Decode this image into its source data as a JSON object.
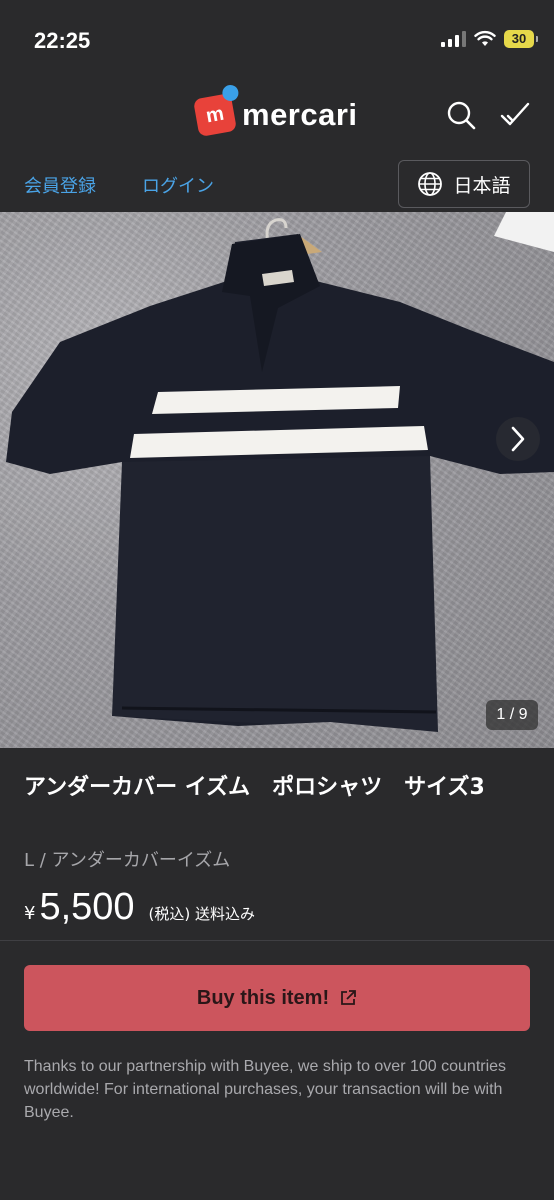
{
  "status_bar": {
    "time": "22:25",
    "battery": "30"
  },
  "header": {
    "logo_text": "mercari",
    "logo_mark": "m",
    "icons": [
      "search-icon",
      "check-icon"
    ]
  },
  "sub_nav": {
    "register": "会員登録",
    "login": "ログイン",
    "language": "日本語"
  },
  "gallery": {
    "counter": "1 / 9"
  },
  "item": {
    "title": "アンダーカバー イズム　ポロシャツ　サイズ3",
    "subtitle": "L / アンダーカバーイズム",
    "currency": "¥",
    "price": "5,500",
    "price_note": "(税込) 送料込み"
  },
  "buy": {
    "label": "Buy this item!"
  },
  "disclaimer": "Thanks to our partnership with Buyee, we ship to over 100 countries worldwide! For international purchases, your transaction will be with Buyee.",
  "colors": {
    "background": "#2a2a2c",
    "link": "#4aa3e6",
    "buy_button": "#cc555d",
    "brand_red": "#e8423a",
    "brand_blue": "#3aa0e8"
  }
}
